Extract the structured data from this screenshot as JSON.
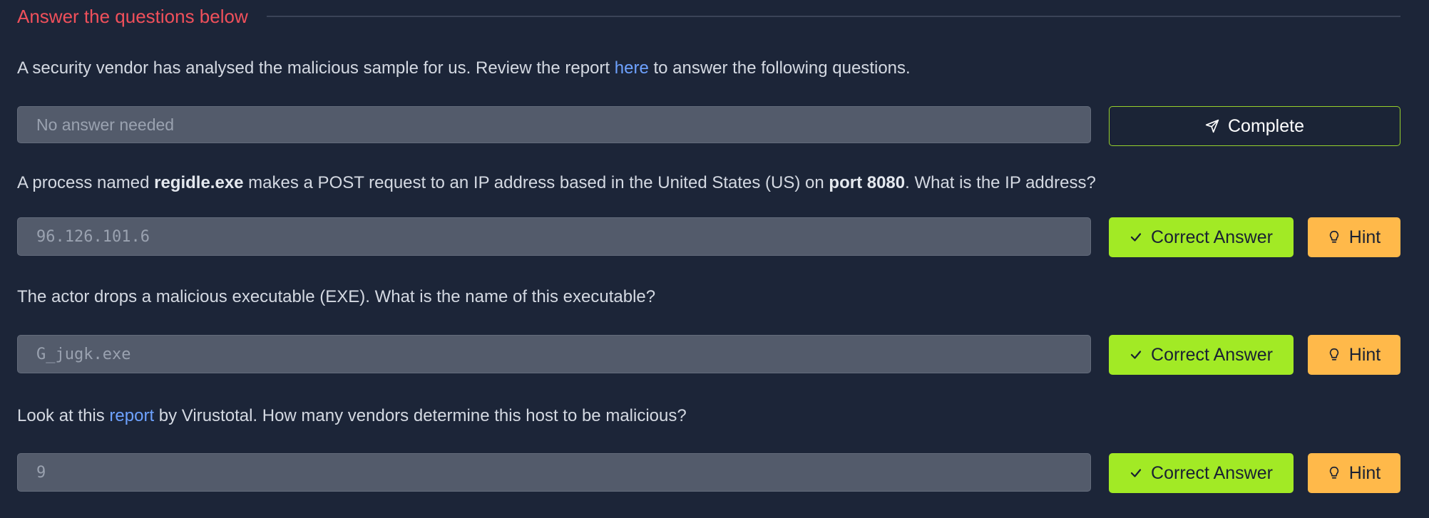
{
  "section": {
    "title": "Answer the questions below"
  },
  "questions": [
    {
      "text_before": "A security vendor has analysed the malicious sample for us. Review the report ",
      "link": "here",
      "text_after": " to answer the following questions.",
      "answer_placeholder": "No answer needed",
      "button_label": "Complete"
    },
    {
      "text_1": "A process named ",
      "bold_1": "regidle.exe",
      "text_2": " makes a POST request to an IP address based in the United States (US) on ",
      "bold_2": "port 8080",
      "text_3": ". What is the IP address?",
      "answer": "96.126.101.6",
      "button_label": "Correct Answer",
      "hint_label": "Hint"
    },
    {
      "text": "The actor drops a malicious executable (EXE). What is the name of this executable?",
      "answer": "G_jugk.exe",
      "button_label": "Correct Answer",
      "hint_label": "Hint"
    },
    {
      "text_before": "Look at this ",
      "link": "report",
      "text_after": " by Virustotal. How many vendors determine this host to be malicious?",
      "answer": "9",
      "button_label": "Correct Answer",
      "hint_label": "Hint"
    }
  ],
  "icons": {
    "complete": "send-icon",
    "correct": "check-icon",
    "hint": "lightbulb-icon"
  },
  "colors": {
    "background": "#1c2538",
    "title": "#f0505b",
    "link": "#6ea2ff",
    "correct": "#a2ea25",
    "hint": "#ffb94a",
    "complete_border": "#96d02c"
  }
}
